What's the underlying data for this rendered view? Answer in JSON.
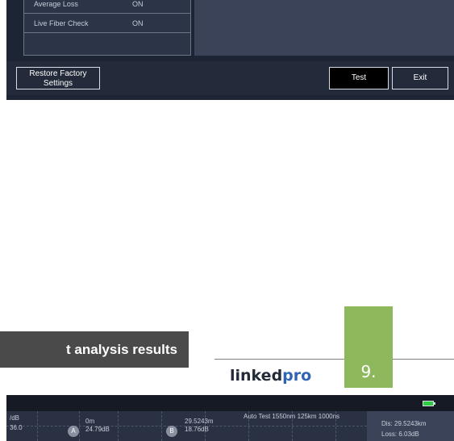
{
  "settings_panel": {
    "rows": [
      {
        "label": "Average Loss",
        "value": "ON"
      },
      {
        "label": "Live Fiber Check",
        "value": "ON"
      }
    ]
  },
  "device_toolbar": {
    "restore_line1": "Restore Factory",
    "restore_line2": "Settings",
    "test_label": "Test",
    "exit_label": "Exit"
  },
  "section_heading": "t analysis results",
  "page_number": "9.",
  "logo": {
    "part1": "linked",
    "part2": "pro"
  },
  "colors": {
    "accent_green": "#8db85b",
    "logo_blue": "#2f64b4"
  },
  "trace": {
    "y_unit": "/dB",
    "y_value": "36.0",
    "marker_a": {
      "label": "A",
      "distance": "0m",
      "loss": "24.79dB"
    },
    "marker_b": {
      "label": "B",
      "distance": "29.5243m",
      "loss": "18.76dB"
    },
    "test_info": "Auto Test  1550nm  125km 1000ns"
  },
  "info_box": {
    "distance": "Dis: 29.5243km",
    "loss": "Loss: 6.03dB"
  }
}
